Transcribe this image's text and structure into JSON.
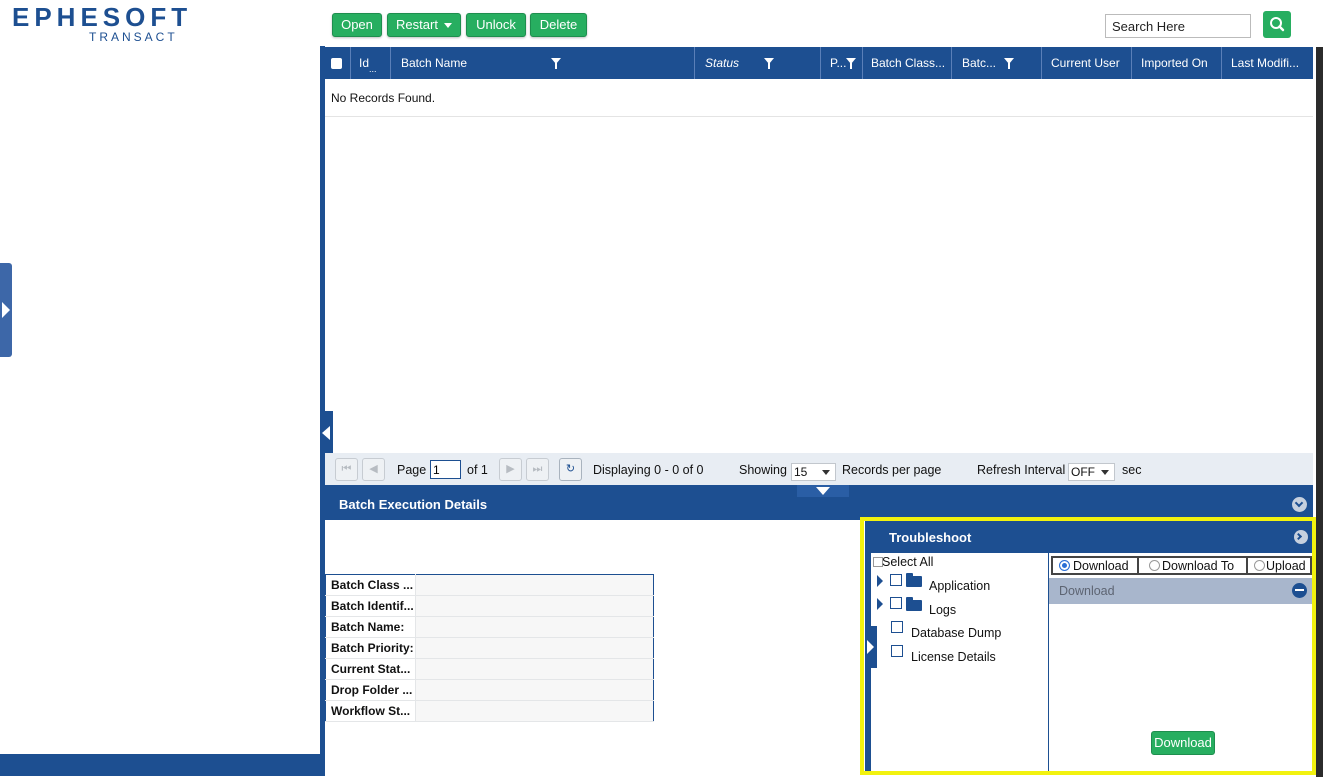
{
  "logo": {
    "main": "EPHESOFT",
    "sub": "TRANSACT"
  },
  "toolbar": {
    "open": "Open",
    "restart": "Restart",
    "unlock": "Unlock",
    "delete": "Delete",
    "accent": "#27ae60"
  },
  "search": {
    "placeholder": "Search Here"
  },
  "grid": {
    "columns": [
      "Id",
      "Batch Name",
      "Status",
      "P...",
      "Batch Class...",
      "Batc...",
      "Current User",
      "Imported On",
      "Last Modifi..."
    ],
    "id_ellipsis": "...",
    "empty_message": "No Records Found.",
    "header_color": "#1d4f91"
  },
  "pager": {
    "page_label": "Page",
    "page_value": "1",
    "of_label": "of 1",
    "displaying": "Displaying 0 - 0 of 0",
    "showing_label": "Showing",
    "per_page_value": "15",
    "per_page_label": "Records per page",
    "refresh_label": "Refresh Interval",
    "refresh_value": "OFF",
    "refresh_unit": "sec"
  },
  "batch_details": {
    "title": "Batch Execution Details",
    "rows": [
      "Batch Class ...",
      "Batch Identif...",
      "Batch Name:",
      "Batch Priority:",
      "Current Stat...",
      "Drop Folder ...",
      "Workflow St..."
    ]
  },
  "troubleshoot": {
    "title": "Troubleshoot",
    "select_all": "Select All",
    "tree": [
      "Application",
      "Logs",
      "Database Dump",
      "License Details"
    ],
    "options": [
      "Download",
      "Download To",
      "Upload"
    ],
    "selected_option": "Download",
    "section_title": "Download",
    "download_button": "Download",
    "highlight_color": "#f2f20f"
  }
}
